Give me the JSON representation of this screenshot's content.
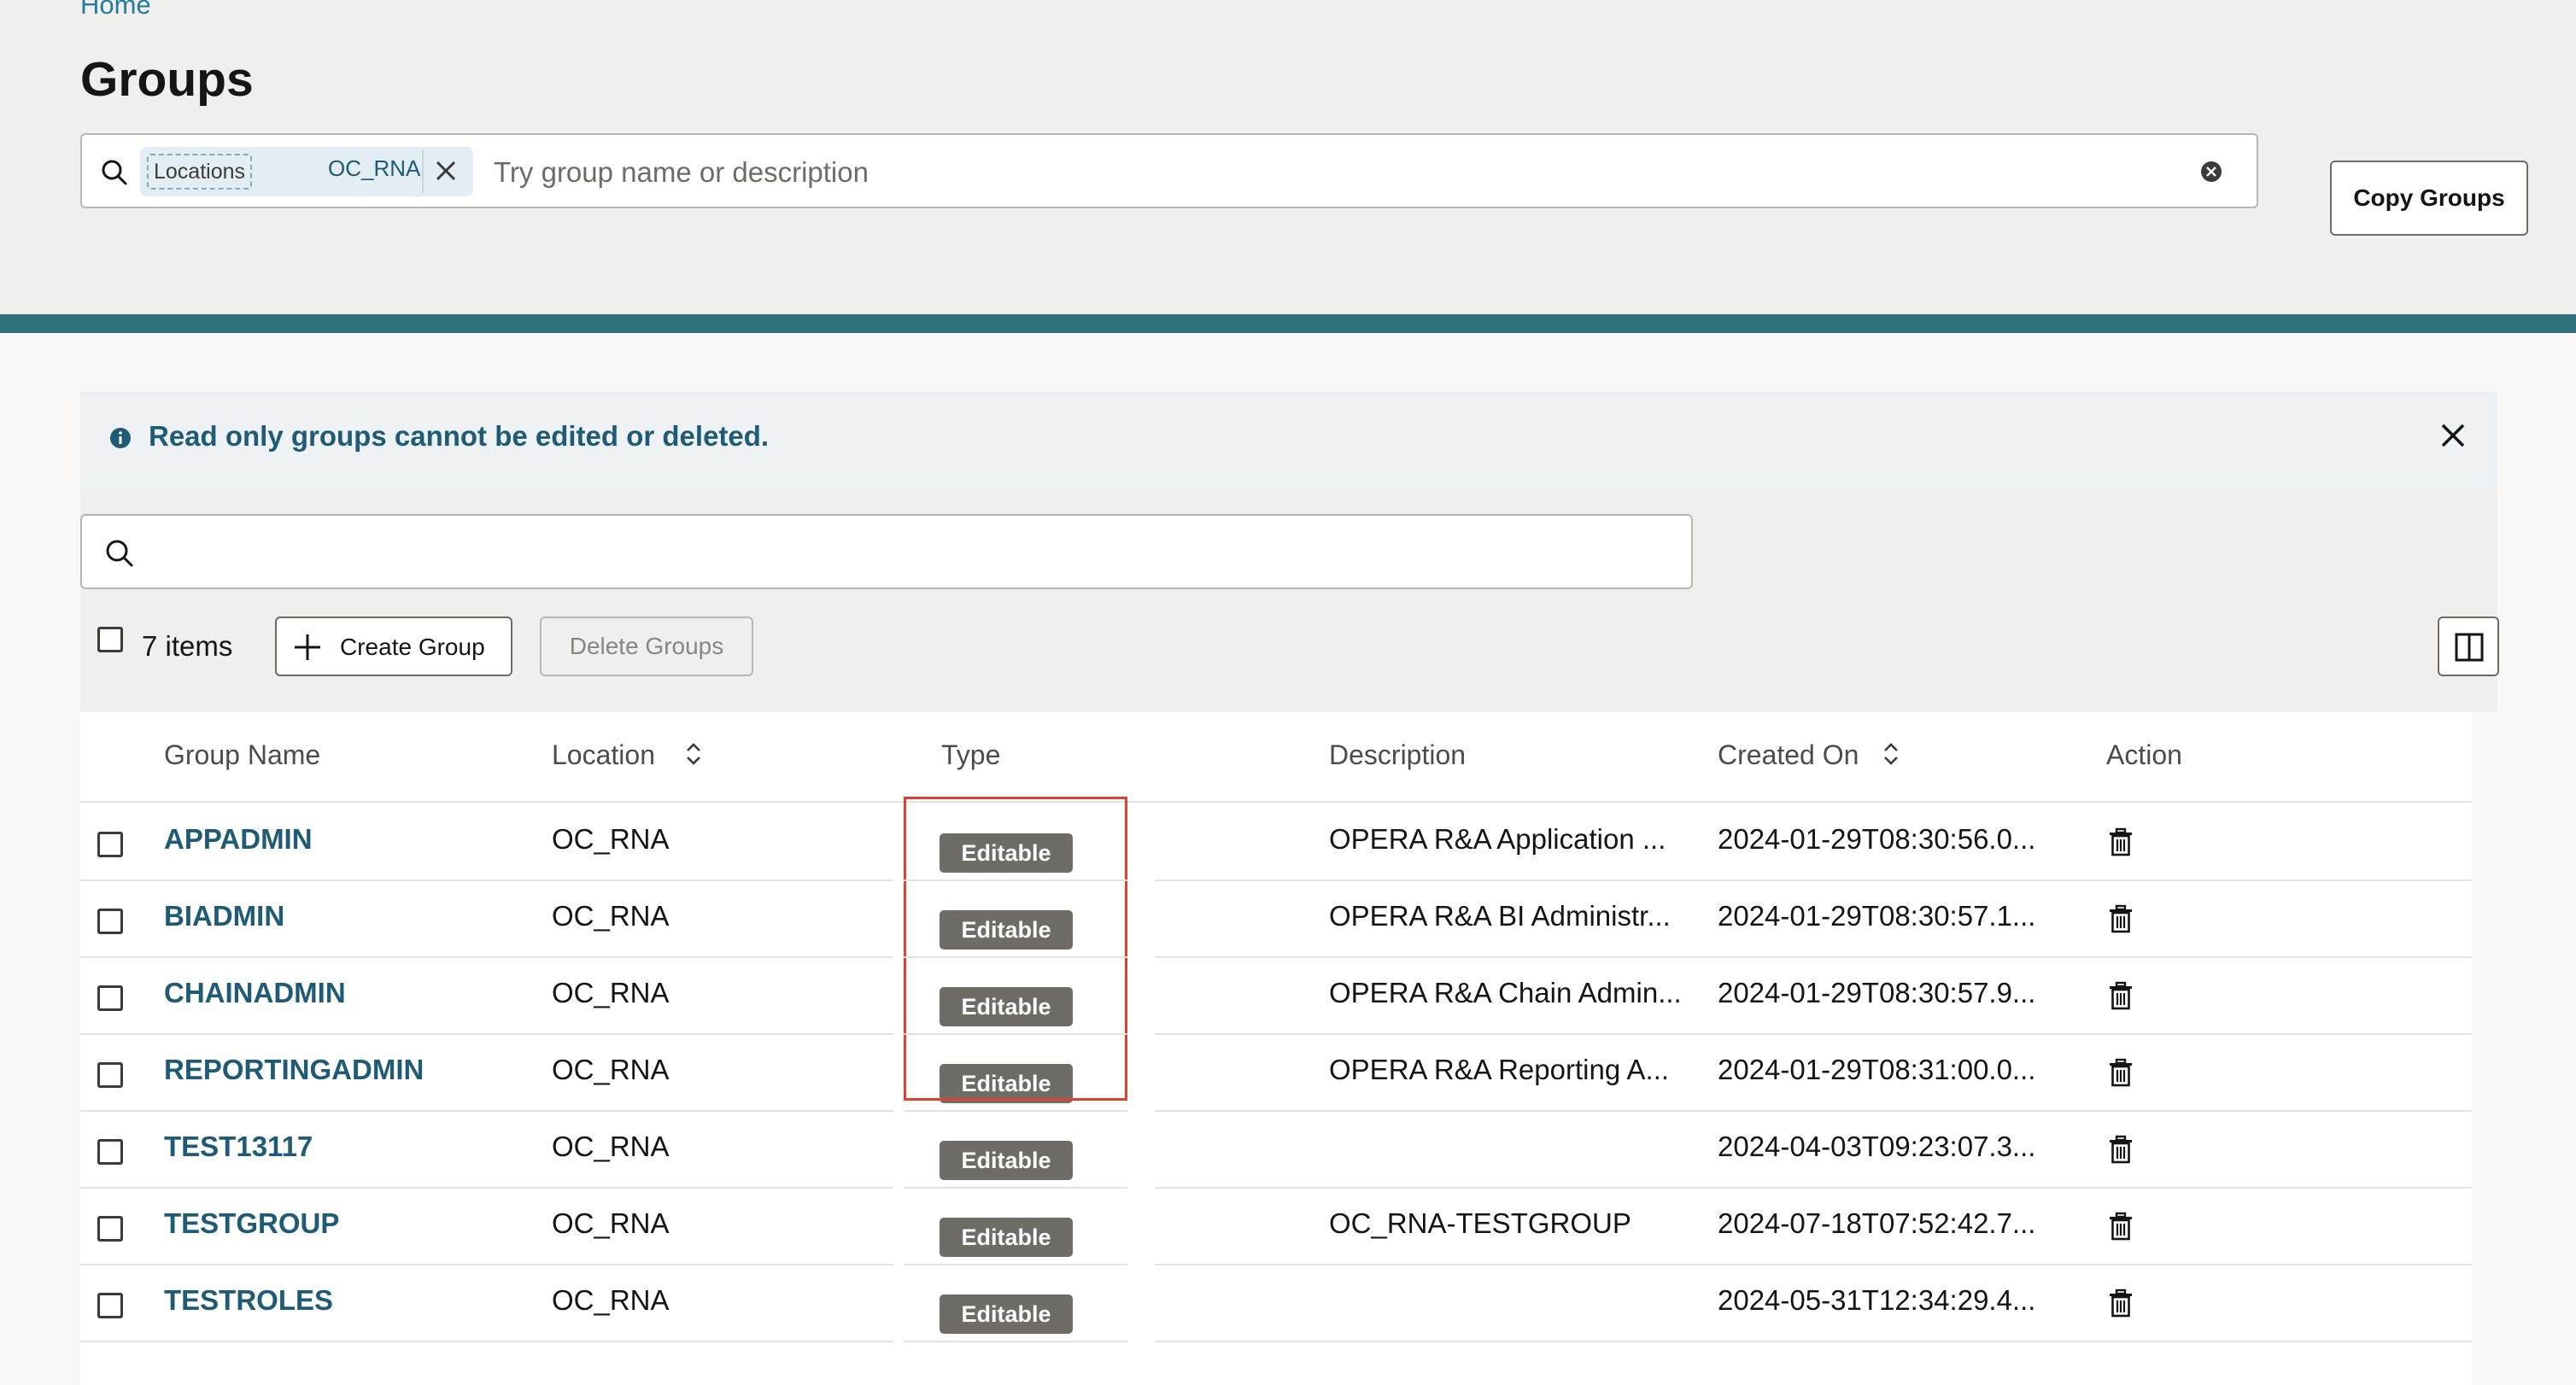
{
  "breadcrumb": "Home",
  "page_title": "Groups",
  "top_search": {
    "filter_chip_key": "Locations",
    "filter_chip_value": "OC_RNA",
    "placeholder": "Try group name or description"
  },
  "copy_groups_label": "Copy Groups",
  "banner": {
    "message": "Read only groups cannot be edited or deleted."
  },
  "table_search": {
    "value": ""
  },
  "toolbar": {
    "items_count": "7 items",
    "create_label": "Create Group",
    "delete_label": "Delete Groups"
  },
  "columns": {
    "group_name": "Group Name",
    "location": "Location",
    "type": "Type",
    "description": "Description",
    "created_on": "Created On",
    "action": "Action"
  },
  "rows": [
    {
      "name": "APPADMIN",
      "location": "OC_RNA",
      "type": "Editable",
      "description": "OPERA R&A Application ...",
      "created_on": "2024-01-29T08:30:56.0..."
    },
    {
      "name": "BIADMIN",
      "location": "OC_RNA",
      "type": "Editable",
      "description": "OPERA R&A BI Administr...",
      "created_on": "2024-01-29T08:30:57.1..."
    },
    {
      "name": "CHAINADMIN",
      "location": "OC_RNA",
      "type": "Editable",
      "description": "OPERA R&A Chain Admin...",
      "created_on": "2024-01-29T08:30:57.9..."
    },
    {
      "name": "REPORTINGADMIN",
      "location": "OC_RNA",
      "type": "Editable",
      "description": "OPERA R&A Reporting A...",
      "created_on": "2024-01-29T08:31:00.0..."
    },
    {
      "name": "TEST13117",
      "location": "OC_RNA",
      "type": "Editable",
      "description": "",
      "created_on": "2024-04-03T09:23:07.3..."
    },
    {
      "name": "TESTGROUP",
      "location": "OC_RNA",
      "type": "Editable",
      "description": "OC_RNA-TESTGROUP",
      "created_on": "2024-07-18T07:52:42.7..."
    },
    {
      "name": "TESTROLES",
      "location": "OC_RNA",
      "type": "Editable",
      "description": "",
      "created_on": "2024-05-31T12:34:29.4..."
    }
  ],
  "icons": {
    "search": "search-icon",
    "chip_remove": "close-icon",
    "clear": "clear-circle-icon",
    "info": "info-icon",
    "banner_close": "close-icon",
    "create": "plus-icon",
    "columns": "column-layout-icon",
    "sort": "sort-icon",
    "delete_row": "trash-icon"
  },
  "colors": {
    "accent_link": "#1f5b75",
    "band": "#2f6f79",
    "badge_bg": "#6f6b67",
    "highlight_box": "#e0402f"
  }
}
